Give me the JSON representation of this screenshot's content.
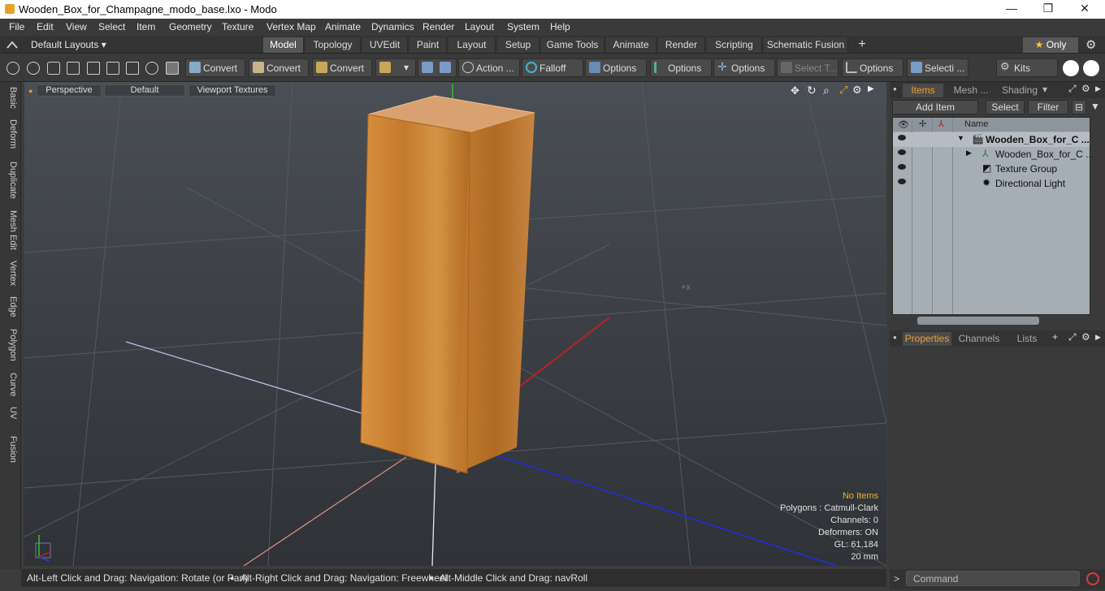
{
  "window": {
    "title": "Wooden_Box_for_Champagne_modo_base.lxo - Modo",
    "minimize": "—",
    "maximize": "❐",
    "close": "✕"
  },
  "menu": [
    "File",
    "Edit",
    "View",
    "Select",
    "Item",
    "Geometry",
    "Texture",
    "Vertex Map",
    "Animate",
    "Dynamics",
    "Render",
    "Layout",
    "System",
    "Help"
  ],
  "layouts_label": "Default Layouts",
  "tabs": [
    "Model",
    "Topology",
    "UVEdit",
    "Paint",
    "Layout",
    "Setup",
    "Game Tools",
    "Animate",
    "Render",
    "Scripting",
    "Schematic Fusion"
  ],
  "active_tab": "Model",
  "add_tab": "+",
  "only_label": "Only",
  "toolbar": {
    "convert1": "Convert",
    "convert2": "Convert",
    "convert3": "Convert",
    "action": "Action ...",
    "falloff": "Falloff",
    "options1": "Options",
    "options2": "Options",
    "options3": "Options",
    "select_t": "Select T...",
    "options4": "Options",
    "selecti": "Selecti ...",
    "kits": "Kits"
  },
  "sidebar_tabs": [
    "Basic",
    "Deform",
    "Duplicate",
    "Mesh Edit",
    "Vertex",
    "Edge",
    "Polygon",
    "Curve",
    "UV",
    "Fusion"
  ],
  "viewport": {
    "view_mode": "Perspective",
    "shading": "Default",
    "textures": "Viewport Textures",
    "info": {
      "selection": "No Items",
      "polygons": "Polygons : Catmull-Clark",
      "channels": "Channels: 0",
      "deformers": "Deformers: ON",
      "gl": "GL: 61,184",
      "scale": "20 mm"
    }
  },
  "status": {
    "hint1": "Alt-Left Click and Drag: Navigation: Rotate (or Pan)",
    "hint2": "Alt-Right Click and Drag: Navigation: Freewheel",
    "hint3": "Alt-Middle Click and Drag: navRoll"
  },
  "items_panel": {
    "tabs": [
      "Items",
      "Mesh ...",
      "Shading"
    ],
    "add_item": "Add Item",
    "select": "Select",
    "filter": "Filter",
    "name_header": "Name",
    "rows": [
      {
        "name": "Wooden_Box_for_C ...",
        "bold": true
      },
      {
        "name": "Wooden_Box_for_C ...",
        "bold": false
      },
      {
        "name": "Texture Group",
        "bold": false
      },
      {
        "name": "Directional Light",
        "bold": false
      }
    ]
  },
  "properties_panel": {
    "tabs": [
      "Properties",
      "Channels",
      "Lists"
    ]
  },
  "command_placeholder": "Command"
}
